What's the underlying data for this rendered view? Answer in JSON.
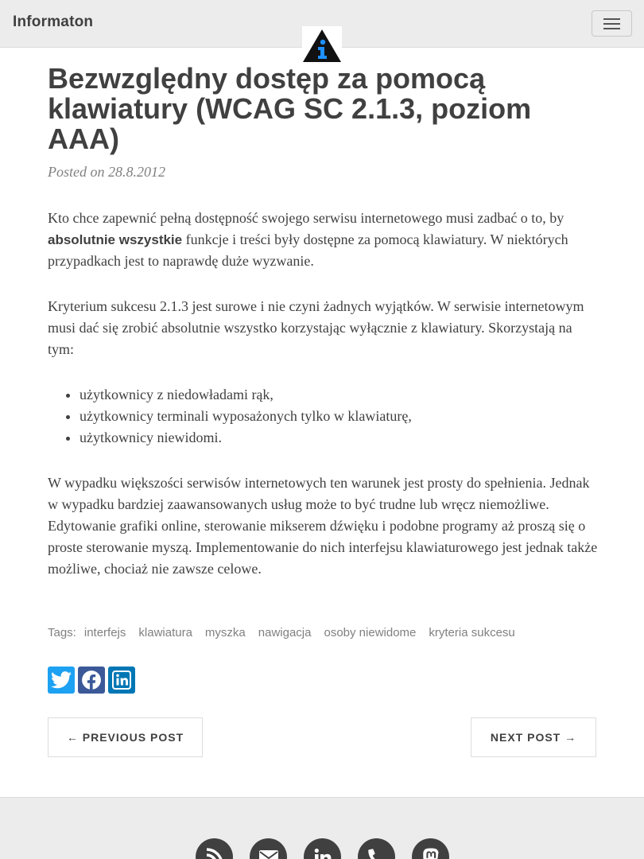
{
  "navbar": {
    "brand": "Informaton",
    "menu_icon": "hamburger-icon",
    "logo_icon": "info-triangle-logo"
  },
  "post": {
    "title": "Bezwzględny dostęp za pomocą klawiatury (WCAG SC 2.1.3, poziom AAA)",
    "meta": "Posted on 28.8.2012",
    "p1_before": "Kto chce zapewnić pełną dostępność swojego serwisu internetowego musi zadbać o to, by ",
    "p1_bold": "absolutnie wszystkie",
    "p1_after": " funkcje i treści były dostępne za pomocą klawiatury. W niektórych przypadkach jest to naprawdę duże wyzwanie.",
    "p2": "Kryterium sukcesu 2.1.3 jest surowe i nie czyni żadnych wyjątków. W serwisie internetowym musi dać się zrobić absolutnie wszystko korzystając wyłącznie z klawiatury. Skorzystają na tym:",
    "list": [
      "użytkownicy z niedowładami rąk,",
      "użytkownicy terminali wyposażonych tylko w klawiaturę,",
      "użytkownicy niewidomi."
    ],
    "p3": "W wypadku większości serwisów internetowych ten warunek jest prosty do spełnienia. Jednak w wypadku bardziej zaawansowanych usług może to być trudne lub wręcz niemożliwe. Edytowanie grafiki online, sterowanie mikserem dźwięku i podobne programy aż proszą się o proste sterowanie myszą. Implementowanie do nich interfejsu klawiaturowego jest jednak także możliwe, chociaż nie zawsze celowe."
  },
  "tags": {
    "label": "Tags:",
    "items": [
      "interfejs",
      "klawiatura",
      "myszka",
      "nawigacja",
      "osoby niewidome",
      "kryteria sukcesu"
    ]
  },
  "share": {
    "icons": [
      "twitter-icon",
      "facebook-icon",
      "linkedin-icon"
    ]
  },
  "pager": {
    "previous": "← PREVIOUS POST",
    "next": "NEXT POST →"
  },
  "footer": {
    "icons": [
      "rss-icon",
      "email-icon",
      "linkedin-icon",
      "phone-icon",
      "mastodon-icon"
    ]
  },
  "colors": {
    "navbar_bg": "#ececec",
    "text": "#404040",
    "muted": "#808080",
    "twitter": "#1da1f2",
    "facebook": "#3b5998",
    "linkedin": "#0077b5",
    "logo_accent": "#1e90ff"
  }
}
